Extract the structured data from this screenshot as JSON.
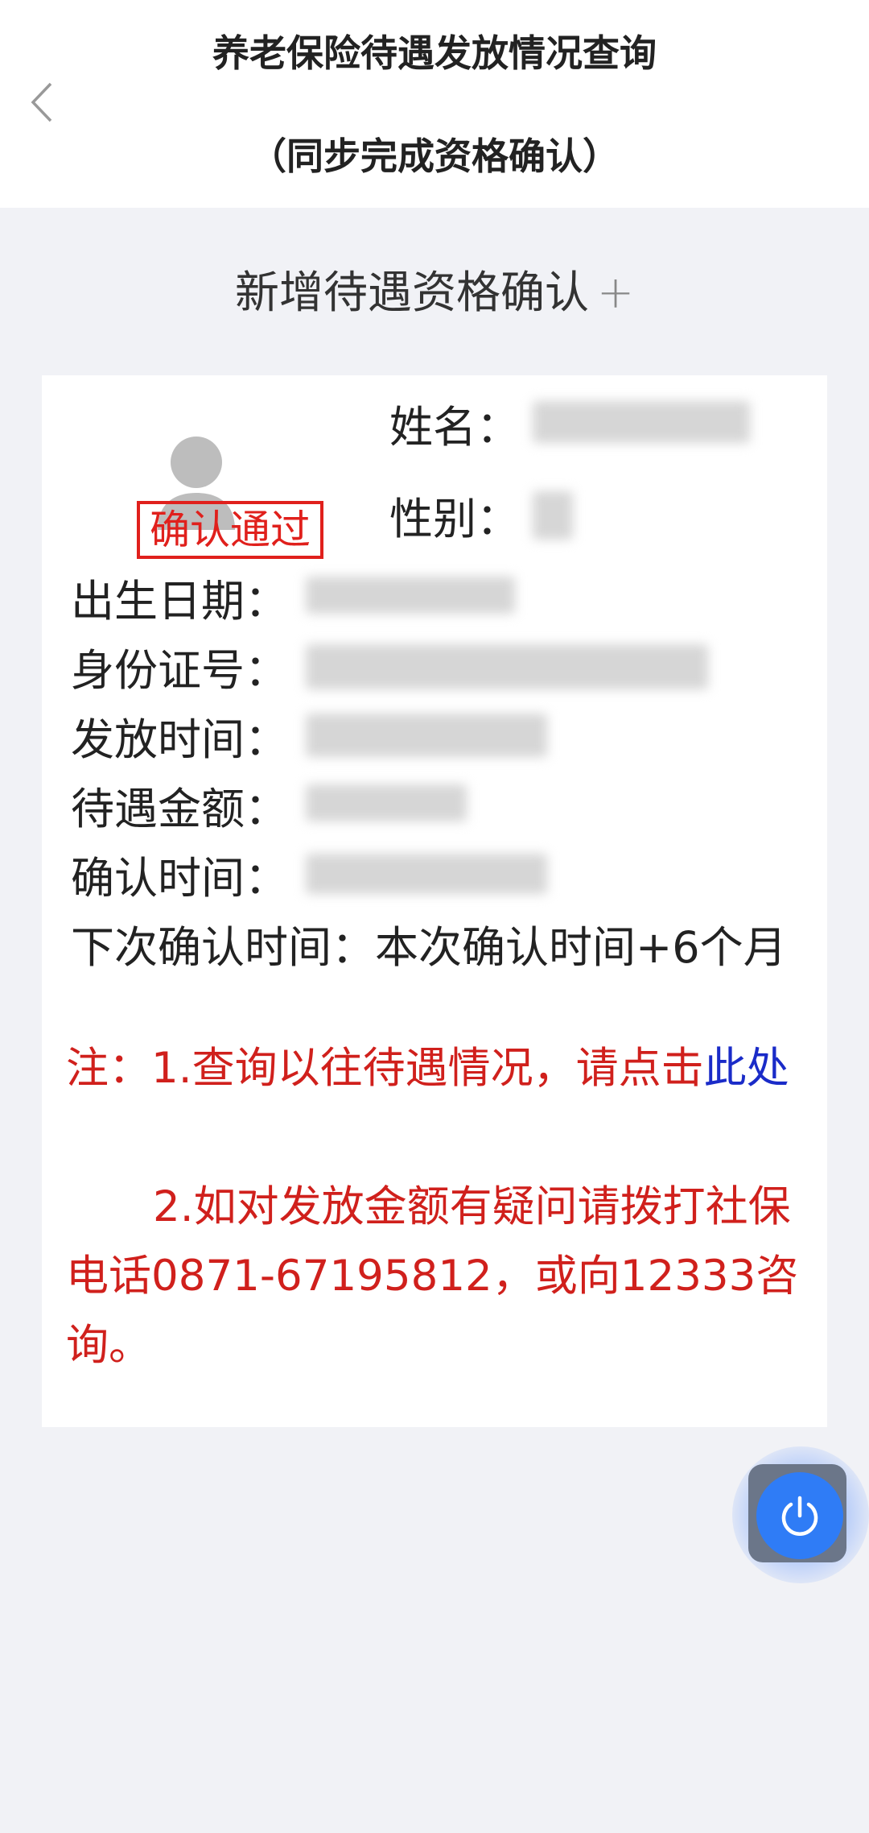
{
  "header": {
    "title_line1": "养老保险待遇发放情况查询",
    "title_line2": "（同步完成资格确认）"
  },
  "add_entry": {
    "label": "新增待遇资格确认",
    "plus": "+"
  },
  "record": {
    "status_badge": "确认通过",
    "name_label": "姓名：",
    "gender_label": "性别：",
    "birth_label": "出生日期：",
    "id_label": "身份证号：",
    "pay_time_label": "发放时间：",
    "amount_label": "待遇金额：",
    "confirm_time_label": "确认时间：",
    "next_confirm_label": "下次确认时间：",
    "next_confirm_value": "本次确认时间+6个月"
  },
  "notes": {
    "line1_prefix": "注：1.查询以往待遇情况，请点击",
    "line1_link": "此处",
    "line2": "2.如对发放金额有疑问请拨打社保电话0871-67195812，或向12333咨询。"
  },
  "icons": {
    "back": "chevron-left-icon",
    "avatar": "user-avatar-icon",
    "power": "power-icon"
  },
  "colors": {
    "accent_red": "#d0201c",
    "link_blue": "#1a2bc8",
    "power_blue": "#2f7cf6"
  }
}
